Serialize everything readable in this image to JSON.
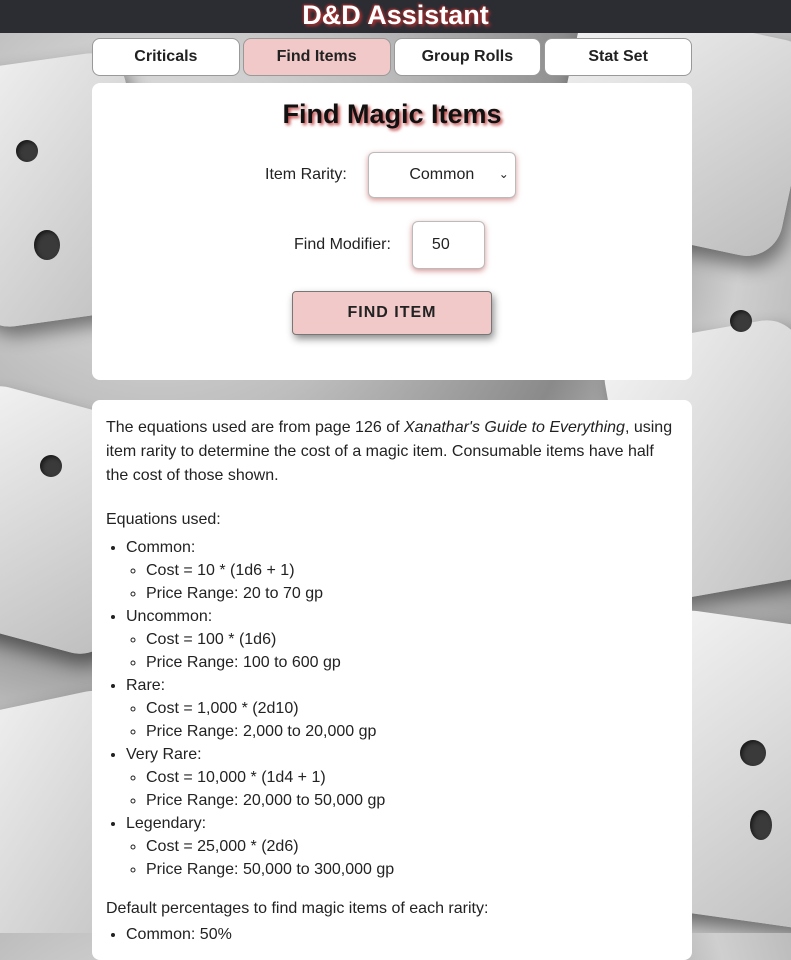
{
  "app": {
    "title": "D&D Assistant"
  },
  "tabs": [
    {
      "label": "Criticals"
    },
    {
      "label": "Find Items"
    },
    {
      "label": "Group Rolls"
    },
    {
      "label": "Stat Set"
    }
  ],
  "find": {
    "title": "Find Magic Items",
    "rarity_label": "Item Rarity:",
    "rarity_value": "Common",
    "modifier_label": "Find Modifier:",
    "modifier_value": "50",
    "button_label": "FIND ITEM"
  },
  "info": {
    "intro_pre": "The equations used are from page 126 of ",
    "intro_book": "Xanathar's Guide to Everything",
    "intro_post": ", using item rarity to determine the cost of a magic item. Consumable items have half the cost of those shown.",
    "equations_heading": "Equations used:",
    "equations": [
      {
        "name": "Common:",
        "cost": "Cost = 10 * (1d6 + 1)",
        "range": "Price Range: 20 to 70 gp"
      },
      {
        "name": "Uncommon:",
        "cost": "Cost = 100 * (1d6)",
        "range": "Price Range: 100 to 600 gp"
      },
      {
        "name": "Rare:",
        "cost": "Cost = 1,000 * (2d10)",
        "range": "Price Range: 2,000 to 20,000 gp"
      },
      {
        "name": "Very Rare:",
        "cost": "Cost = 10,000 * (1d4 + 1)",
        "range": "Price Range: 20,000 to 50,000 gp"
      },
      {
        "name": "Legendary:",
        "cost": "Cost = 25,000 * (2d6)",
        "range": "Price Range: 50,000 to 300,000 gp"
      }
    ],
    "defaults_heading": "Default percentages to find magic items of each rarity:",
    "defaults": [
      {
        "text": "Common: 50%"
      }
    ]
  },
  "colors": {
    "topbar": "#2b2d33",
    "accent": "#f2c9c9",
    "title_shadow": "#c04040"
  }
}
